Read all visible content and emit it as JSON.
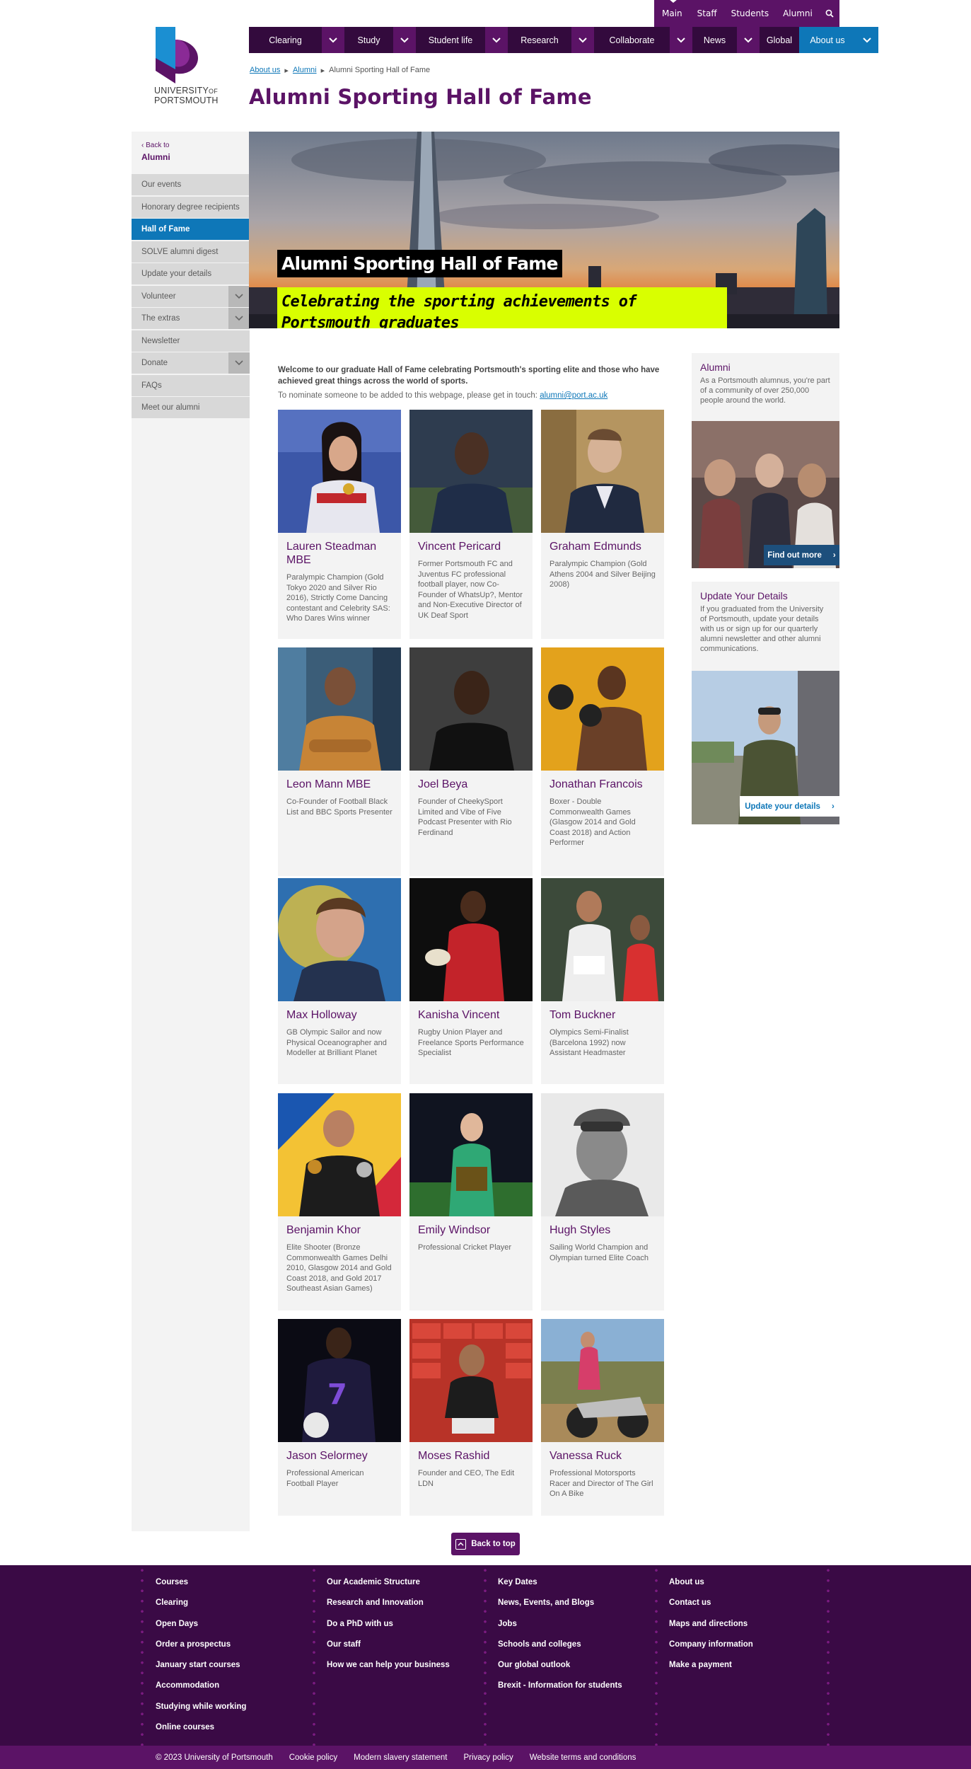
{
  "utility": {
    "items": [
      "Main",
      "Staff",
      "Students",
      "Alumni"
    ]
  },
  "logo": {
    "line1": "UNIVERSITY",
    "line1b": "OF",
    "line2": "PORTSMOUTH"
  },
  "nav": {
    "items": [
      "Clearing",
      "Study",
      "Student life",
      "Research",
      "Collaborate",
      "News",
      "Global",
      "About us"
    ]
  },
  "breadcrumb": {
    "items": [
      "About us",
      "Alumni",
      "Alumni Sporting Hall of Fame"
    ]
  },
  "page_title": "Alumni Sporting Hall of Fame",
  "sidebar": {
    "back_label": "Back to",
    "back_parent": "Alumni",
    "items": [
      "Our events",
      "Honorary degree recipients",
      "Hall of Fame",
      "SOLVE alumni digest",
      "Update your details",
      "Volunteer",
      "The extras",
      "Newsletter",
      "Donate",
      "FAQs",
      "Meet our alumni"
    ]
  },
  "hero": {
    "title": "Alumni Sporting Hall of Fame",
    "subtitle": "Celebrating the sporting achievements of Portsmouth graduates"
  },
  "intro": {
    "bold": "Welcome to our graduate Hall of Fame celebrating Portsmouth's sporting elite and those who have achieved great things across the world of sports.",
    "nominate": "To nominate someone to be added to this webpage, please get in touch:",
    "email": "alumni@port.ac.uk"
  },
  "cards": [
    {
      "name": "Lauren Steadman MBE",
      "desc": "Paralympic Champion (Gold Tokyo 2020 and Silver Rio 2016), Strictly Come Dancing contestant and  Celebrity SAS: Who Dares Wins winner"
    },
    {
      "name": "Vincent Pericard",
      "desc": "Former Portsmouth FC and Juventus FC professional football player, now Co-Founder of WhatsUp?, Mentor and Non-Executive Director of UK Deaf Sport"
    },
    {
      "name": "Graham Edmunds",
      "desc": "Paralympic Champion (Gold Athens 2004 and Silver Beijing 2008)"
    },
    {
      "name": "Leon Mann MBE",
      "desc": "Co-Founder of Football Black List and BBC Sports Presenter"
    },
    {
      "name": "Joel Beya",
      "desc": "Founder of CheekySport Limited and Vibe of Five Podcast Presenter with Rio Ferdinand"
    },
    {
      "name": "Jonathan Francois",
      "desc": "Boxer - Double Commonwealth Games (Glasgow 2014 and Gold Coast 2018) and Action Performer"
    },
    {
      "name": "Max Holloway",
      "desc": "GB Olympic Sailor and now Physical Oceanographer and Modeller at Brilliant Planet"
    },
    {
      "name": "Kanisha Vincent",
      "desc": "Rugby Union Player and Freelance Sports Performance Specialist"
    },
    {
      "name": "Tom Buckner",
      "desc": "Olympics Semi-Finalist (Barcelona 1992) now Assistant Headmaster"
    },
    {
      "name": "Benjamin Khor",
      "desc": "Elite Shooter (Bronze Commonwealth Games Delhi 2010, Glasgow 2014 and Gold Coast 2018, and Gold 2017 Southeast Asian Games)"
    },
    {
      "name": "Emily Windsor",
      "desc": "Professional Cricket Player"
    },
    {
      "name": "Hugh Styles",
      "desc": "Sailing World Champion and Olympian turned Elite Coach"
    },
    {
      "name": "Jason Selormey",
      "desc": "Professional American Football Player"
    },
    {
      "name": "Moses Rashid",
      "desc": "Founder and CEO, The Edit LDN"
    },
    {
      "name": "Vanessa Ruck",
      "desc": "Professional Motorsports Racer and Director of The Girl On A Bike"
    }
  ],
  "right": {
    "alumni_heading": "Alumni",
    "alumni_text": "As a Portsmouth alumnus, you're part of a community of over 250,000 people around the world.",
    "alumni_button": "Find out more",
    "update_heading": "Update Your Details",
    "update_text": "If you graduated from the University of Portsmouth, update your details with us or sign up for our quarterly alumni newsletter and other alumni communications.",
    "update_button": "Update your details"
  },
  "back_to_top": "Back to top",
  "footer": {
    "col1": [
      "Courses",
      "Clearing",
      "Open Days",
      "Order a prospectus",
      "January start courses",
      "Accommodation",
      "Studying while working",
      "Online courses"
    ],
    "col2": [
      "Our Academic Structure",
      "Research and Innovation",
      "Do a PhD with us",
      "Our staff",
      "How we can help your business"
    ],
    "col3": [
      "Key Dates",
      "News, Events, and Blogs",
      "Jobs",
      "Schools and colleges",
      "Our global outlook",
      "Brexit - Information for students"
    ],
    "col4": [
      "About us",
      "Contact us",
      "Maps and directions",
      "Company information",
      "Make a payment"
    ]
  },
  "legal": [
    "© 2023 University of Portsmouth",
    "Cookie policy",
    "Modern slavery statement",
    "Privacy policy",
    "Website terms and conditions"
  ],
  "colors": {
    "purple": "#5b1366",
    "dark_purple": "#330a3d",
    "blue": "#0e77b8",
    "hero_yellow": "#d9ff00"
  }
}
